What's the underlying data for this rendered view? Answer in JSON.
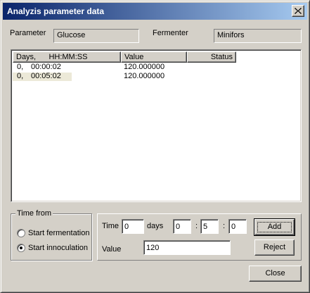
{
  "window": {
    "title": "Analyzis parameter data"
  },
  "header": {
    "parameter_label": "Parameter",
    "parameter_value": "Glucose",
    "fermenter_label": "Fermenter",
    "fermenter_value": "Minifors"
  },
  "list": {
    "columns": [
      "Days,      HH:MM:SS",
      "Value",
      "Status"
    ],
    "rows": [
      {
        "days": "0,",
        "time": "00:00:02",
        "value": "120.000000",
        "status": ""
      },
      {
        "days": "0,",
        "time": "00:05:02",
        "value": "120.000000",
        "status": ""
      }
    ]
  },
  "time_from": {
    "title": "Time from",
    "options": [
      "Start fermentation",
      "Start innoculation"
    ],
    "selected_index": 1
  },
  "entry": {
    "time_label": "Time",
    "days_value": "0",
    "days_label": "days",
    "hours_value": "0",
    "minutes_value": "5",
    "seconds_value": "0",
    "colon": ":",
    "value_label": "Value",
    "value_value": "120"
  },
  "buttons": {
    "add": "Add",
    "reject": "Reject",
    "close": "Close"
  }
}
